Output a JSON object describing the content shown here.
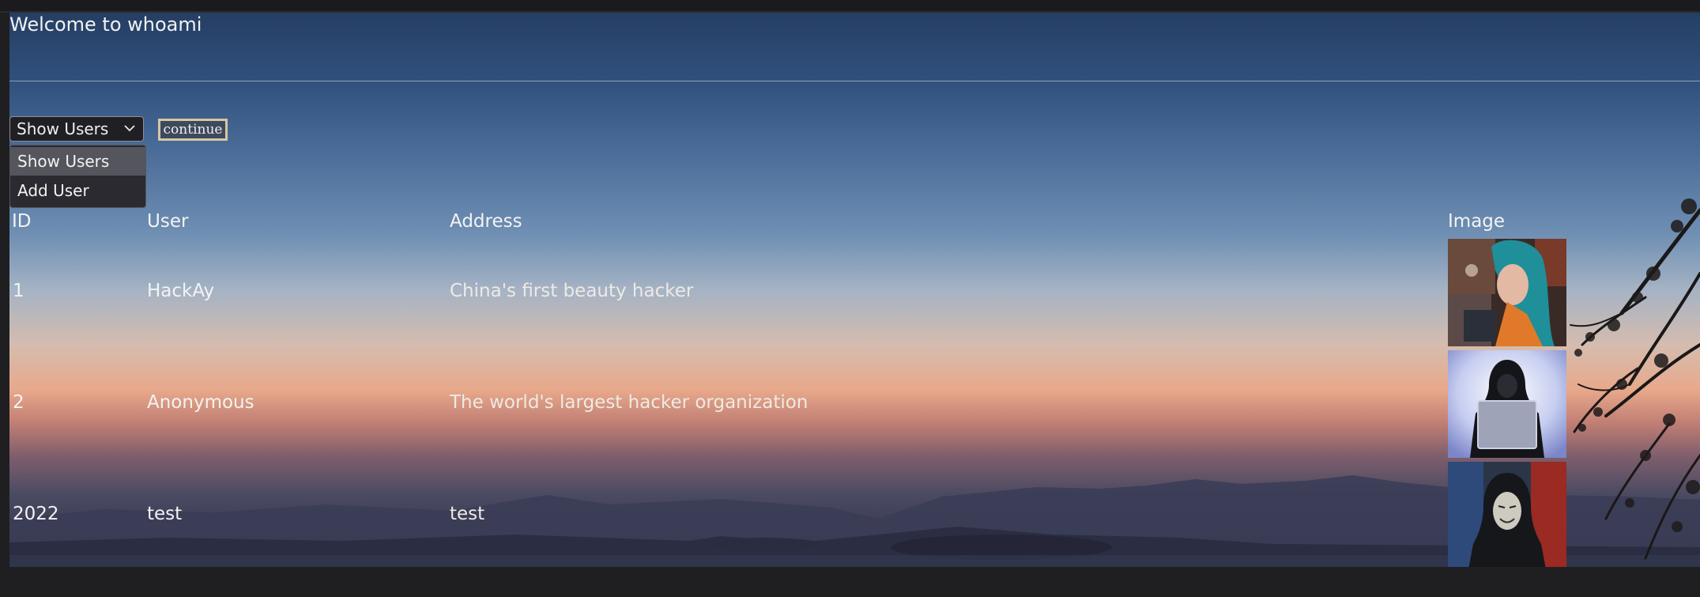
{
  "page": {
    "title": "Welcome to whoami"
  },
  "form": {
    "select_value": "Show Users",
    "options": [
      "Show Users",
      "Add User"
    ],
    "continue_label": "continue"
  },
  "table": {
    "headers": [
      "ID",
      "User",
      "Address",
      "Image"
    ],
    "rows": [
      {
        "id": "1",
        "user": "HackAy",
        "address": "China's first beauty hacker",
        "image": "photo of teal-haired woman at computer"
      },
      {
        "id": "2",
        "user": "Anonymous",
        "address": "The world's largest hacker organization",
        "image": "hooded figure with laptop"
      },
      {
        "id": "2022",
        "user": "test",
        "address": "test",
        "image": "hooded figure with mask"
      }
    ]
  },
  "colors": {
    "sky_top": "#253e63",
    "sunset": "#e8a98b",
    "button_border": "#d6c7a1"
  }
}
